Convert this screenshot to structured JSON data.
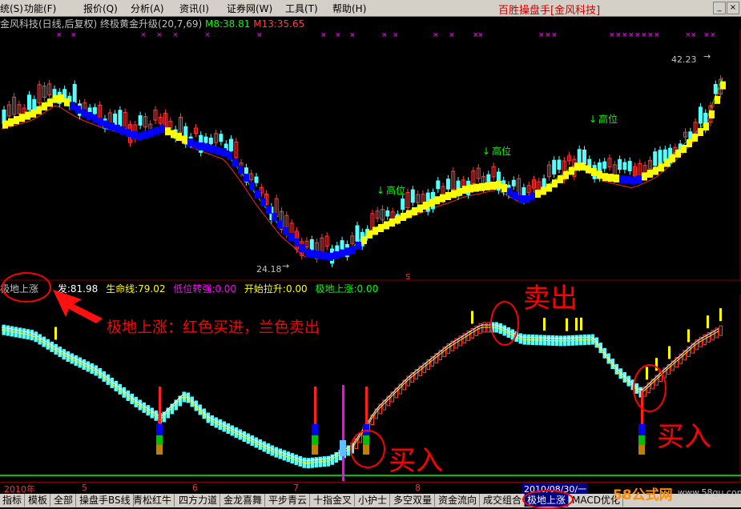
{
  "menu": {
    "items": [
      "统(S)",
      "功能(F)",
      "报价(Q)",
      "分析(A)",
      "资讯(I)",
      "证券网(W)",
      "工具(T)",
      "帮助(H)"
    ],
    "brand": "百胜操盘手[金风科技]",
    "win_min": "_",
    "win_close": "×"
  },
  "header": {
    "stock": "金风科技(日线,后复权)",
    "indicator": "终极黄金升级(20,7,69)",
    "m8": "M8:38.81",
    "m13": "M13:35.65"
  },
  "main_chart": {
    "price_high": "42.23",
    "price_low": "24.18",
    "labels": [
      "高位",
      "高位",
      "高位"
    ],
    "s_marker": "S"
  },
  "indicator_row": {
    "name": "极地上涨",
    "line1": "发:81.98",
    "lifeline": "生命线:79.02",
    "low_strong": "低位转强:0.00",
    "start_rise": "开始拉升:0.00",
    "polar_rise": "极地上涨:0.00"
  },
  "time_axis": {
    "labels": [
      "2010年",
      "5",
      "6",
      "7",
      "8"
    ],
    "cursor_date": "2010/08/30/一"
  },
  "tabs": [
    "指标",
    "模板",
    "全部",
    "操盘手BS线",
    "青松红牛",
    "四方力道",
    "金龙喜舞",
    "平步青云",
    "十指金叉",
    "小护士",
    "多空双量",
    "资金流向",
    "成交组合",
    "极地上涨",
    "MACD优化"
  ],
  "active_tab": "极地上涨",
  "annotations": {
    "desc": "极地上涨：红色买进，兰色卖出",
    "sell": "卖出",
    "buy1": "买入",
    "buy2": "买入"
  },
  "watermark": {
    "logo": "58公式网",
    "url": "www.58gu.com"
  },
  "colors": {
    "up": "#ff3b3b",
    "down": "#54ffff",
    "yellow": "#ffff00",
    "blue": "#0000ff",
    "magenta": "#ff00ff",
    "bg": "#000000",
    "annotation": "#ff0000"
  }
}
